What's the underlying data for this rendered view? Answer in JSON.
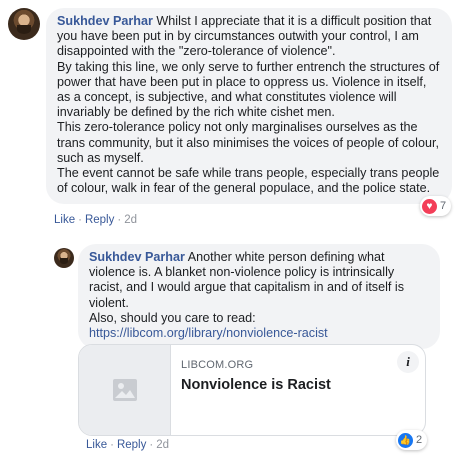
{
  "comment1": {
    "author": "Sukhdev Parhar",
    "paragraphs": [
      "Whilst I appreciate that it is a difficult position that you have been put in by circumstances outwith your control, I am disappointed with the \"zero-tolerance of violence\".",
      "By taking this line, we only serve to further entrench the structures of power that have been put in place to oppress us. Violence in itself, as a concept, is subjective, and what constitutes violence will invariably be defined by the rich white cishet men.",
      "This zero-tolerance policy not only marginalises ourselves as the trans community, but it also minimises the voices of people of colour, such as myself.",
      "The event cannot be safe while trans people, especially trans people of colour, walk in fear of the general populace, and the police state."
    ],
    "reaction_icon": "heart-icon",
    "reaction_count": "7",
    "actions": {
      "like": "Like",
      "reply": "Reply",
      "separator": "·",
      "time": "2d"
    }
  },
  "comment2": {
    "author": "Sukhdev Parhar",
    "lines": [
      "Another white person defining what violence is. A blanket non-violence policy is intrinsically racist, and I would argue that capitalism in and of itself is violent.",
      "Also, should you care to read:"
    ],
    "link": "https://libcom.org/library/nonviolence-racist",
    "card": {
      "domain": "LIBCOM.ORG",
      "title": "Nonviolence is Racist",
      "thumb_icon": "image-placeholder-icon",
      "info_icon": "info-icon",
      "info_glyph": "i"
    },
    "reaction_icon": "thumbs-up-icon",
    "reaction_count": "2",
    "actions": {
      "like": "Like",
      "reply": "Reply",
      "separator": "·",
      "time": "2d"
    }
  },
  "colors": {
    "bubble_bg": "#f2f3f5",
    "author": "#385898",
    "heart": "#f33e58",
    "like": "#1877f2"
  }
}
